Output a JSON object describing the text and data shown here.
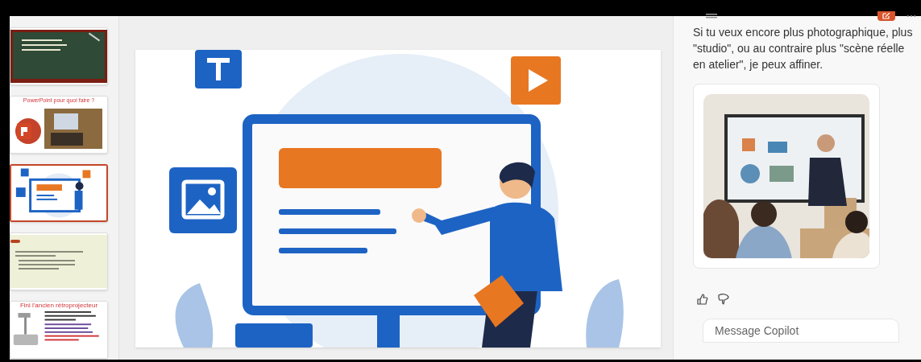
{
  "slides": [
    {
      "kind": "chalkboard",
      "selected": false
    },
    {
      "kind": "title-photo",
      "title": "PowerPoint pour quoi faire ?",
      "selected": false
    },
    {
      "kind": "illustration",
      "selected": true
    },
    {
      "kind": "text",
      "selected": false
    },
    {
      "kind": "projector",
      "title": "Fini l'ancien rétroprojecteur",
      "selected": false
    }
  ],
  "copilot": {
    "message": "Si tu veux encore plus photographique, plus \"studio\", ou au contraire plus \"scène réelle en atelier\", je peux affiner.",
    "input": {
      "placeholder": "Message Copilot"
    }
  }
}
